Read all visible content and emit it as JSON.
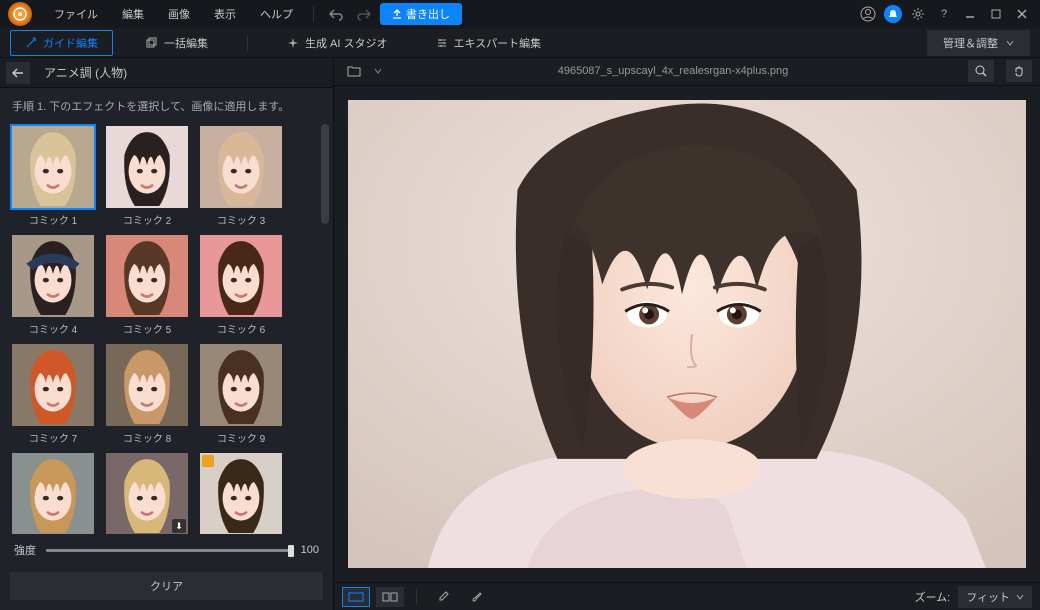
{
  "menu": {
    "file": "ファイル",
    "edit": "編集",
    "image": "画像",
    "view": "表示",
    "help": "ヘルプ"
  },
  "export_label": "書き出し",
  "modes": {
    "guide": "ガイド編集",
    "batch": "一括編集",
    "ai_studio": "生成 AI スタジオ",
    "expert": "エキスパート編集"
  },
  "manage_label": "管理＆調整",
  "sidebar": {
    "category": "アニメ調 (人物)",
    "instruction": "手順 1. 下のエフェクトを選択して、画像に適用します。",
    "effects": [
      {
        "label": "コミック 1",
        "hair": "#d9c49a",
        "bg": "#b8a890",
        "selected": true
      },
      {
        "label": "コミック 2",
        "hair": "#2a2020",
        "bg": "#e8d8d8"
      },
      {
        "label": "コミック 3",
        "hair": "#d8b898",
        "bg": "#c8b0a0"
      },
      {
        "label": "コミック 4",
        "hair": "#2a2020",
        "bg": "#a89888",
        "hat": true
      },
      {
        "label": "コミック 5",
        "hair": "#5a3828",
        "bg": "#d88878"
      },
      {
        "label": "コミック 6",
        "hair": "#4a2818",
        "bg": "#e89898"
      },
      {
        "label": "コミック 7",
        "hair": "#d05828",
        "bg": "#887868"
      },
      {
        "label": "コミック 8",
        "hair": "#c89868",
        "bg": "#786858"
      },
      {
        "label": "コミック 9",
        "hair": "#4a3020",
        "bg": "#988878"
      },
      {
        "label": "",
        "hair": "#c89858",
        "bg": "#889090"
      },
      {
        "label": "",
        "hair": "#d8b878",
        "bg": "#786868",
        "download": true
      },
      {
        "label": "",
        "hair": "#3a2818",
        "bg": "#d8d0c8",
        "premium": true
      }
    ],
    "strength_label": "強度",
    "strength_value": 100,
    "clear_label": "クリア"
  },
  "canvas": {
    "filename": "4965087_s_upscayl_4x_realesrgan-x4plus.png",
    "zoom_label": "ズーム:",
    "zoom_value": "フィット"
  }
}
